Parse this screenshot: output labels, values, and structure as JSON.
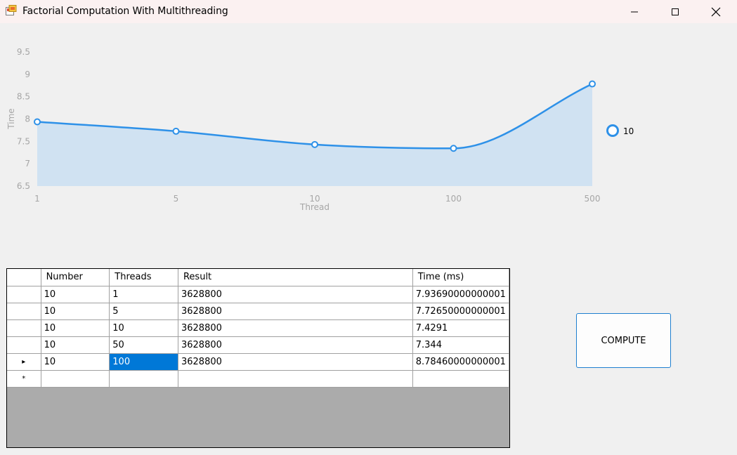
{
  "window": {
    "title": "Factorial Computation With Multithreading",
    "icon": "windows-forms-app-icon",
    "controls": {
      "minimize": "minimize-icon",
      "maximize": "maximize-icon",
      "close": "close-icon"
    }
  },
  "chart_data": {
    "type": "area",
    "xlabel": "Thread",
    "ylabel": "Time",
    "categories": [
      "1",
      "5",
      "10",
      "100",
      "500"
    ],
    "y_ticks": [
      "6.5",
      "7",
      "7.5",
      "8",
      "8.5",
      "9",
      "9.5"
    ],
    "ylim": [
      6.5,
      9.5
    ],
    "series": [
      {
        "name": "10",
        "values": [
          7.9369,
          7.7265,
          7.4291,
          7.344,
          8.7846
        ]
      }
    ],
    "legend_position": "right",
    "colors": {
      "line": "#2e91e8",
      "fill": "#d0e2f2"
    },
    "grid": false
  },
  "grid": {
    "columns": [
      "Number",
      "Threads",
      "Result",
      "Time (ms)"
    ],
    "rows": [
      {
        "number": "10",
        "threads": "1",
        "result": "3628800",
        "time": "7.93690000000001"
      },
      {
        "number": "10",
        "threads": "5",
        "result": "3628800",
        "time": "7.72650000000001"
      },
      {
        "number": "10",
        "threads": "10",
        "result": "3628800",
        "time": "7.4291"
      },
      {
        "number": "10",
        "threads": "50",
        "result": "3628800",
        "time": "7.344"
      },
      {
        "number": "10",
        "threads": "100",
        "result": "3628800",
        "time": "8.78460000000001"
      }
    ],
    "current_row_marker": "▸",
    "new_row_marker": "*"
  },
  "compute_button": {
    "label": "COMPUTE"
  }
}
